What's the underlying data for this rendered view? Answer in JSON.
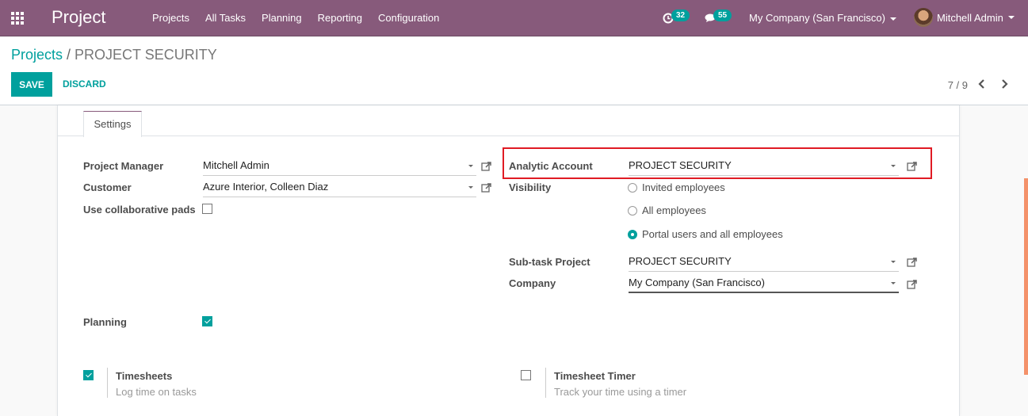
{
  "navbar": {
    "app_title": "Project",
    "menu": [
      "Projects",
      "All Tasks",
      "Planning",
      "Reporting",
      "Configuration"
    ],
    "activity_count": "32",
    "message_count": "55",
    "company": "My Company (San Francisco)",
    "user": "Mitchell Admin"
  },
  "breadcrumb": {
    "parent": "Projects",
    "separator": "/",
    "current": "PROJECT SECURITY"
  },
  "actions": {
    "save": "SAVE",
    "discard": "DISCARD"
  },
  "pager": {
    "value": "7 / 9"
  },
  "tabs": [
    {
      "label": "Settings",
      "active": true
    }
  ],
  "form": {
    "project_manager": {
      "label": "Project Manager",
      "value": "Mitchell Admin"
    },
    "customer": {
      "label": "Customer",
      "value": "Azure Interior, Colleen Diaz"
    },
    "collaborative_pads": {
      "label": "Use collaborative pads",
      "checked": false
    },
    "analytic_account": {
      "label": "Analytic Account",
      "value": "PROJECT SECURITY"
    },
    "visibility": {
      "label": "Visibility",
      "options": [
        "Invited employees",
        "All employees",
        "Portal users and all employees"
      ],
      "selected": "Portal users and all employees"
    },
    "subtask_project": {
      "label": "Sub-task Project",
      "value": "PROJECT SECURITY"
    },
    "company": {
      "label": "Company",
      "value": "My Company (San Francisco)"
    },
    "planning": {
      "label": "Planning",
      "checked": true
    }
  },
  "settings": {
    "timesheets": {
      "title": "Timesheets",
      "description": "Log time on tasks",
      "checked": true
    },
    "timesheet_timer": {
      "title": "Timesheet Timer",
      "description": "Track your time using a timer",
      "checked": false
    }
  },
  "colors": {
    "brand": "#875a7b",
    "accent": "#00a09d",
    "highlight": "#e01b24",
    "scrollbar": "#f4926a"
  }
}
